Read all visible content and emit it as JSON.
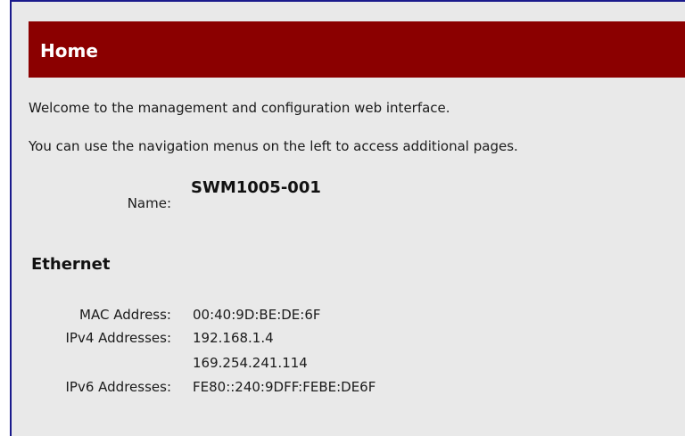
{
  "header": {
    "title": "Home"
  },
  "intro": {
    "line1": "Welcome to the management and configuration web interface.",
    "line2": "You can use the navigation menus on the left to access additional pages."
  },
  "device": {
    "name_label": "Name:",
    "name_value": "SWM1005-001"
  },
  "ethernet": {
    "title": "Ethernet",
    "mac_label": "MAC Address:",
    "mac_value": "00:40:9D:BE:DE:6F",
    "ipv4_label": "IPv4 Addresses:",
    "ipv4_values": [
      "192.168.1.4",
      "169.254.241.114"
    ],
    "ipv6_label": "IPv6 Addresses:",
    "ipv6_values": [
      "FE80::240:9DFF:FEBE:DE6F"
    ]
  },
  "colors": {
    "header_bg": "#8b0000",
    "page_bg": "#e9e9e9",
    "frame_border": "#1a1a8c"
  }
}
